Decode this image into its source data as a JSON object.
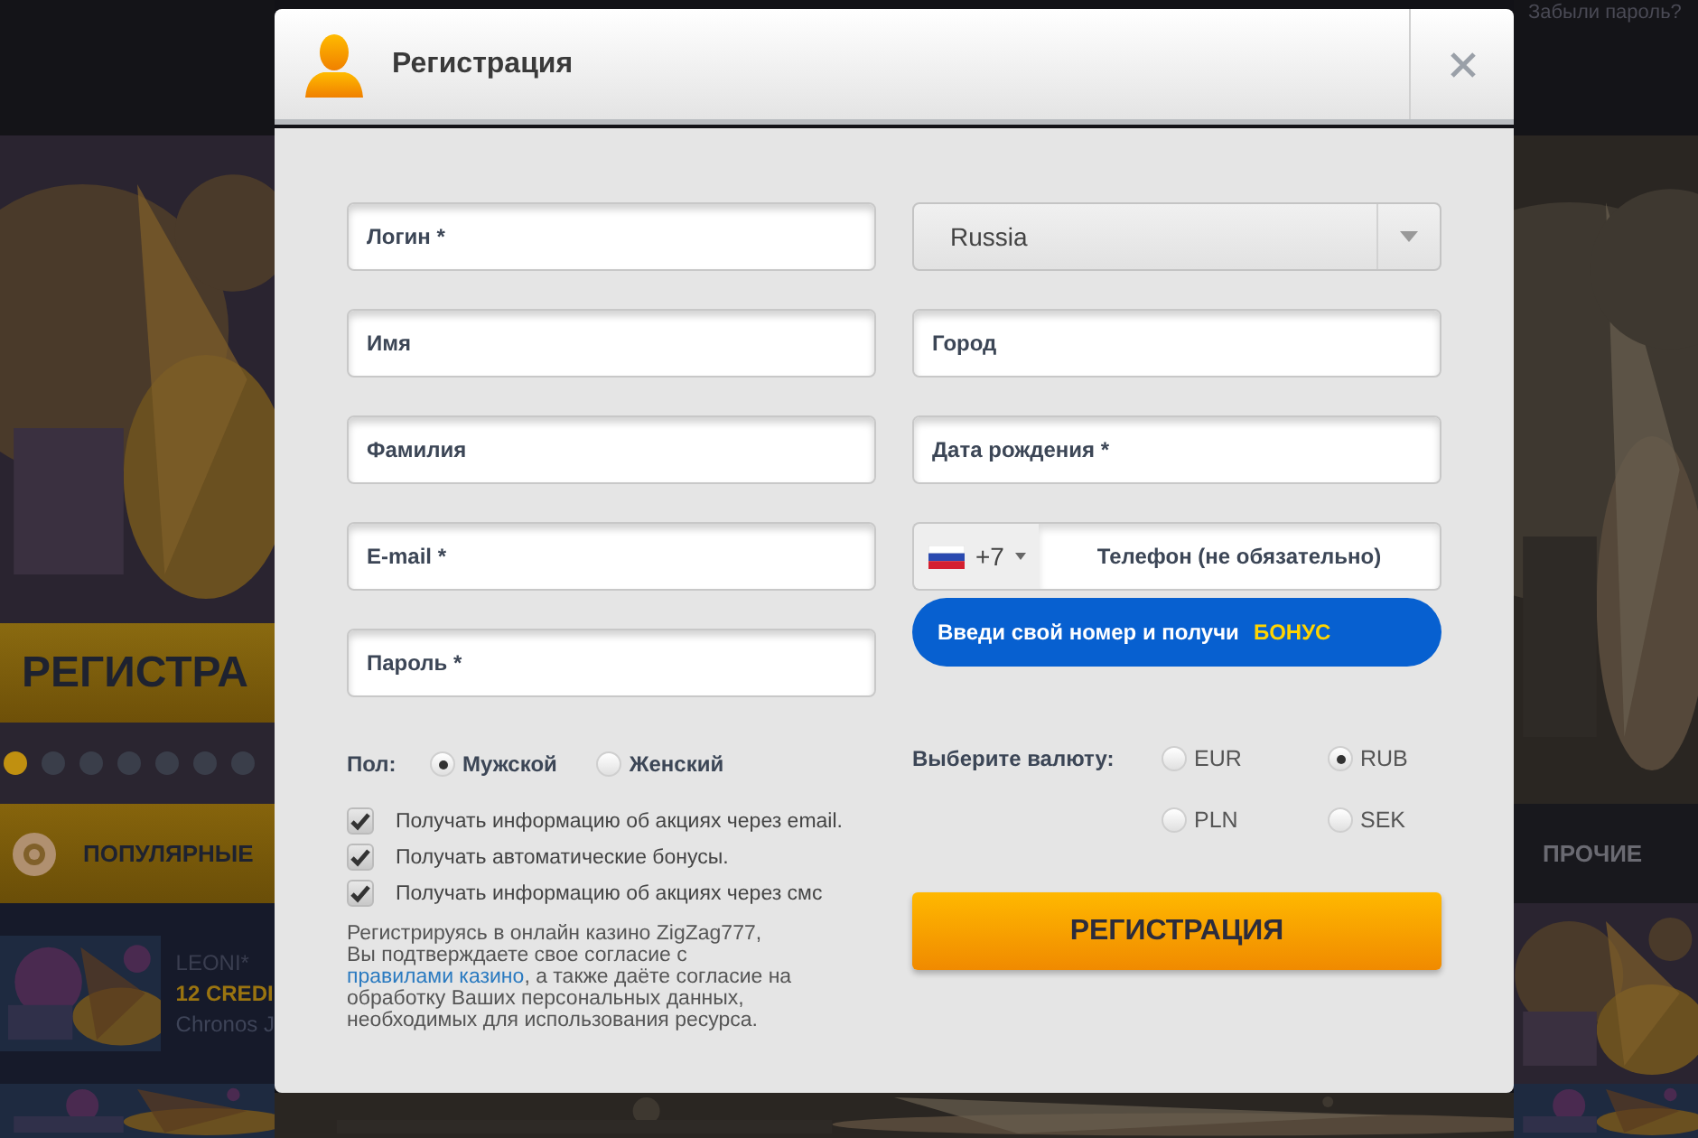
{
  "background": {
    "top_link": "Забыли пароль?",
    "banner_button": "РЕГИСТРА",
    "slides": [
      {
        "selected": true
      },
      {
        "selected": false
      },
      {
        "selected": false
      },
      {
        "selected": false
      },
      {
        "selected": false
      },
      {
        "selected": false
      },
      {
        "selected": false
      }
    ],
    "categories": [
      {
        "label": "ПОПУЛЯРНЫЕ"
      },
      {
        "label": "ПРОЧИЕ"
      }
    ],
    "game": {
      "provider": "LEONI*",
      "prize": "12 CREDI",
      "name": "Chronos J"
    }
  },
  "dialog": {
    "title": "Регистрация",
    "fields_left": [
      {
        "placeholder": "Логин *"
      },
      {
        "placeholder": "Имя"
      },
      {
        "placeholder": "Фамилия"
      },
      {
        "placeholder": "E-mail *"
      },
      {
        "placeholder": "Пароль *"
      }
    ],
    "country": {
      "value": "Russia"
    },
    "fields_right": [
      {
        "placeholder": "Город"
      },
      {
        "placeholder": "Дата рождения *"
      }
    ],
    "phone": {
      "code": "+7",
      "placeholder": "Телефон (не обязательно)"
    },
    "promo": {
      "text": "Введи свой номер и получи",
      "highlight": "БОНУС"
    },
    "gender": {
      "label": "Пол:",
      "options": [
        {
          "label": "Мужской",
          "selected": true
        },
        {
          "label": "Женский",
          "selected": false
        }
      ]
    },
    "checkboxes": [
      {
        "label": "Получать информацию об акциях через email.",
        "checked": true
      },
      {
        "label": "Получать автоматические бонусы.",
        "checked": true
      },
      {
        "label": "Получать информацию об акциях через смс",
        "checked": true
      }
    ],
    "legal": {
      "first_line": "Регистрируясь в онлайн казино ZigZag777,",
      "before_link": "Вы подтверждаете свое согласие с",
      "link": "правилами казино",
      "after_link": ", а также даёте согласие на обработку Ваших персональных данных, необходимых для использования ресурса."
    },
    "currency": {
      "label": "Выберите валюту:",
      "options": [
        {
          "label": "EUR",
          "selected": false
        },
        {
          "label": "RUB",
          "selected": true
        },
        {
          "label": "PLN",
          "selected": false
        },
        {
          "label": "SEK",
          "selected": false
        }
      ]
    },
    "submit": "РЕГИСТРАЦИЯ"
  }
}
